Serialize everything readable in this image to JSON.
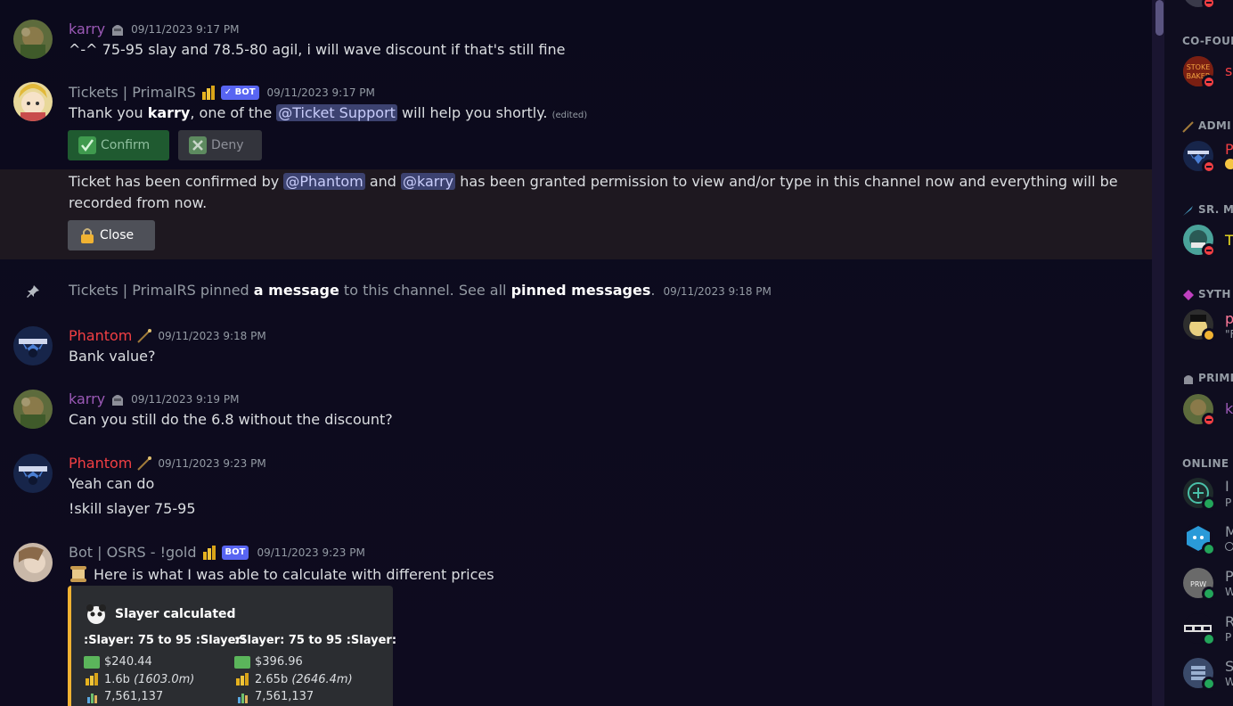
{
  "messages": {
    "m1": {
      "author": "karry",
      "author_color": "#9b59b6",
      "timestamp": "09/11/2023 9:17 PM",
      "text": "^-^ 75-95 slay and 78.5-80 agil, i will wave discount if that's still fine"
    },
    "m2": {
      "author": "Tickets | PrimalRS",
      "bot_tag": "✓ BOT",
      "timestamp": "09/11/2023 9:17 PM",
      "text_a": "Thank you ",
      "text_bold": "karry",
      "text_b": ", one of the ",
      "mention": "@Ticket Support",
      "text_c": " will help you shortly.",
      "edited": "(edited)",
      "confirm_label": "Confirm",
      "deny_label": "Deny"
    },
    "m3": {
      "text_a": "Ticket has been confirmed by ",
      "mention1": "@Phantom",
      "text_b": " and ",
      "mention2": "@karry",
      "text_c": " has been granted permission to view and/or type in this channel now and everything will be",
      "text_d": "recorded from now.",
      "close_label": "Close"
    },
    "m4": {
      "author": "Tickets | PrimalRS",
      "text_a": " pinned ",
      "link1": "a message",
      "text_b": " to this channel. See all ",
      "link2": "pinned messages",
      "text_c": ".",
      "timestamp": "09/11/2023 9:18 PM"
    },
    "m5": {
      "author": "Phantom",
      "author_color": "#f23f43",
      "timestamp": "09/11/2023 9:18 PM",
      "text": "Bank value?"
    },
    "m6": {
      "author": "karry",
      "author_color": "#9b59b6",
      "timestamp": "09/11/2023 9:19 PM",
      "text": "Can you still do the 6.8 without the discount?"
    },
    "m7": {
      "author": "Phantom",
      "author_color": "#f23f43",
      "timestamp": "09/11/2023 9:23 PM",
      "text1": "Yeah can do",
      "text2": "!skill slayer 75-95"
    },
    "m8": {
      "author": "Bot | OSRS - !gold",
      "bot_tag": "BOT",
      "timestamp": "09/11/2023 9:23 PM",
      "text": "Here is what I was able to calculate with different prices"
    }
  },
  "embed": {
    "title": "Slayer calculated",
    "col1": {
      "header": ":Slayer: 75 to 95 :Slayer:",
      "usd": "$240.44",
      "gold": "1.6b",
      "gold_m": "(1603.0m)",
      "xp": "7,561,137"
    },
    "col2": {
      "header": ":Slayer: 75 to 95 :Slayer:",
      "usd": "$396.96",
      "gold": "2.65b",
      "gold_m": "(2646.4m)",
      "xp": "7,561,137"
    }
  },
  "members": {
    "cat1": "CO-FOUN",
    "cat2": "ADMI",
    "cat3": "SR. M",
    "cat4": "SYTH",
    "cat5": "PRIMI",
    "cat6": "ONLINE –",
    "names": [
      "s",
      "P",
      "T",
      "p",
      "k",
      "I",
      "M",
      "P",
      "R",
      "S"
    ],
    "subs": [
      "\"F",
      "P",
      "W",
      "P",
      "W"
    ]
  },
  "colors": {
    "accent": "#5865f2",
    "mention_bg": "#3c4270",
    "phantom": "#f23f43",
    "karry": "#9b59b6",
    "embed_border": "#f0b232"
  }
}
